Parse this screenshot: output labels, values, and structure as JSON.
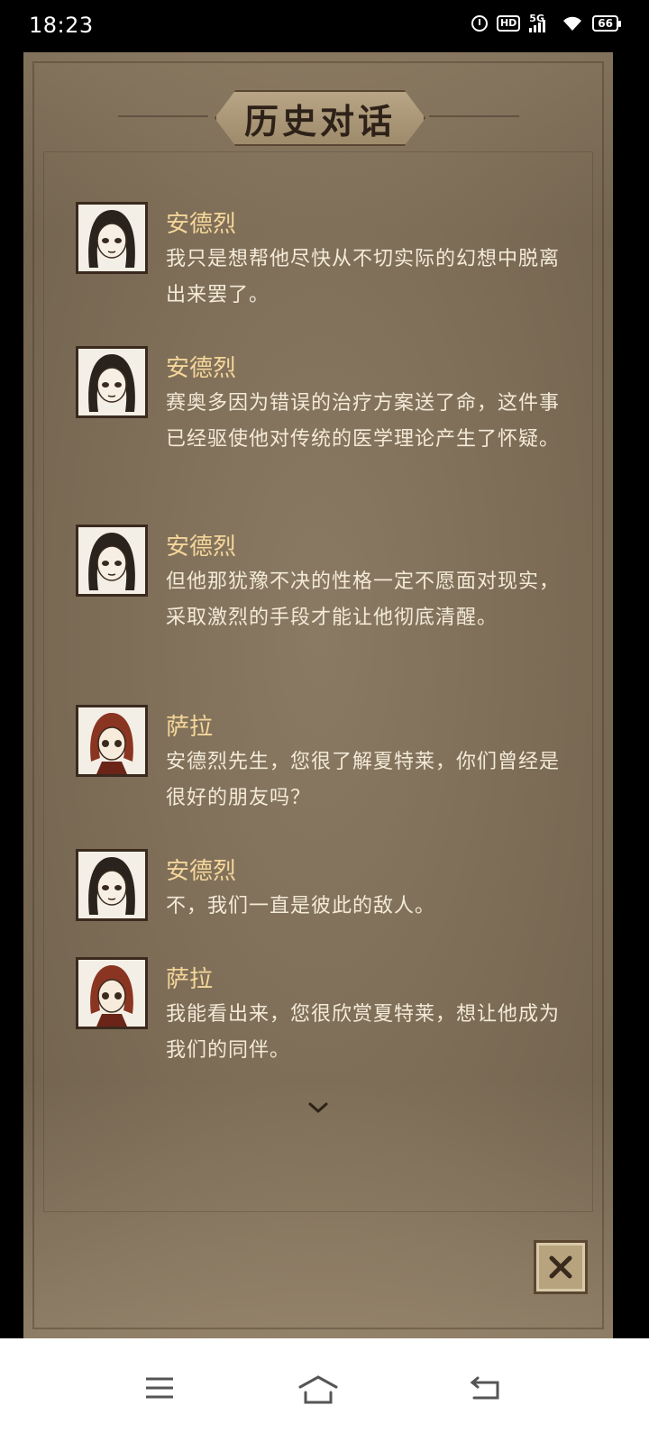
{
  "status_bar": {
    "time": "18:23",
    "hd": "HD",
    "network": "5G",
    "battery": "66",
    "icons": [
      "alarm-icon",
      "hd-icon",
      "signal-5g-icon",
      "wifi-icon",
      "battery-icon"
    ]
  },
  "dialog_panel": {
    "title": "历史对话",
    "close_icon": "close-icon",
    "more_icon": "chevron-down-icon"
  },
  "entries": [
    {
      "speaker": "安德烈",
      "avatar": "andre-avatar",
      "text": "我只是想帮他尽快从不切实际的幻想中脱离出来罢了。"
    },
    {
      "speaker": "安德烈",
      "avatar": "andre-avatar",
      "text": "赛奥多因为错误的治疗方案送了命，这件事已经驱使他对传统的医学理论产生了怀疑。"
    },
    {
      "speaker": "安德烈",
      "avatar": "andre-avatar",
      "text": "但他那犹豫不决的性格一定不愿面对现实，采取激烈的手段才能让他彻底清醒。"
    },
    {
      "speaker": "萨拉",
      "avatar": "sarah-avatar",
      "text": "安德烈先生，您很了解夏特莱，你们曾经是很好的朋友吗？"
    },
    {
      "speaker": "安德烈",
      "avatar": "andre-avatar",
      "text": "不，我们一直是彼此的敌人。"
    },
    {
      "speaker": "萨拉",
      "avatar": "sarah-avatar",
      "text": "我能看出来，您很欣赏夏特莱，想让他成为我们的同伴。"
    }
  ],
  "nav_bar": {
    "icons": [
      "menu-icon",
      "home-icon",
      "back-icon"
    ]
  },
  "colors": {
    "speaker": "#f5d69a",
    "text": "#f3ead8",
    "panel": "#7c6c56"
  }
}
